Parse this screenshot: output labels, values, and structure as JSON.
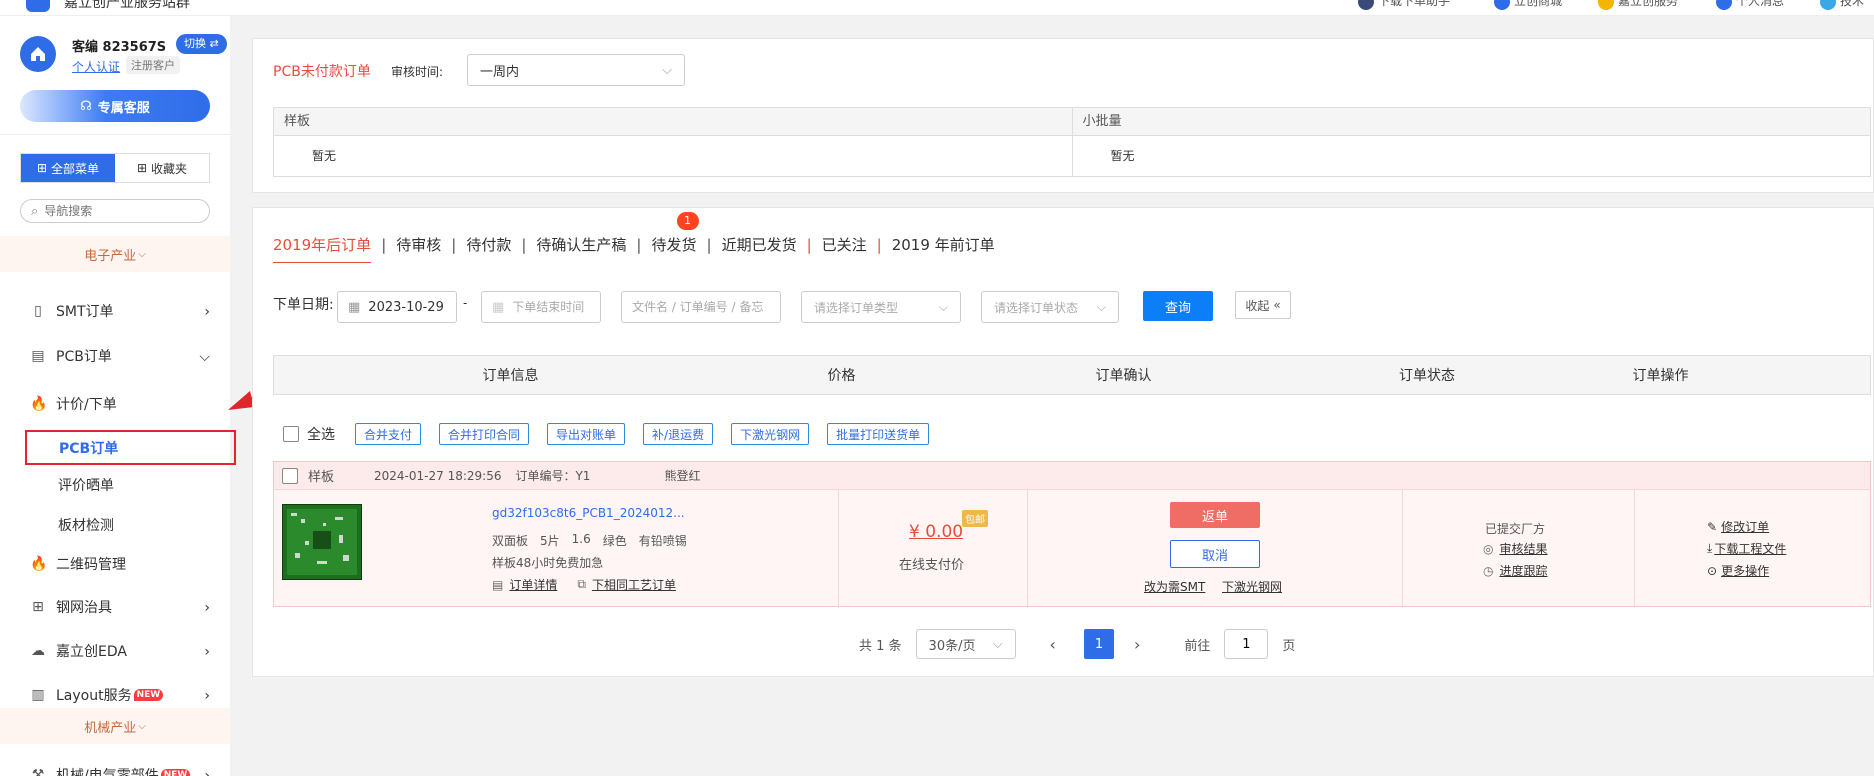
{
  "topbar": {
    "brand": "嘉立创产业服务站群",
    "nav": [
      "下载下单助手",
      "立创商城",
      "嘉立创服务",
      "个人消息",
      "技术"
    ]
  },
  "sidebar": {
    "user_id": "客编 823567S",
    "switch_label": "切换 ⇄",
    "verify_label": "个人认证",
    "reg_tag": "注册客户",
    "service_label": "专属客服",
    "tab_all": "全部菜单",
    "tab_fav": "收藏夹",
    "search_placeholder": "导航搜索",
    "industry_electronics": "电子产业",
    "industry_mech": "机械产业",
    "items": {
      "smt": "SMT订单",
      "pcb": "PCB订单",
      "quote": "计价/下单",
      "pcb_order": "PCB订单",
      "review": "评价晒单",
      "board_test": "板材检测",
      "qr": "二维码管理",
      "stencil": "钢网治具",
      "eda": "嘉立创EDA",
      "layout": "Layout服务",
      "mech": "机械/电气零部件",
      "new": "NEW"
    }
  },
  "unpaid": {
    "title": "PCB未付款订单",
    "review_time_label": "审核时间:",
    "review_time_value": "一周内",
    "col_sample": "样板",
    "col_small": "小批量",
    "empty": "暂无"
  },
  "tabs": {
    "after2019": "2019年后订单",
    "pending_review": "待审核",
    "pending_pay": "待付款",
    "pending_confirm": "待确认生产稿",
    "pending_ship": "待发货",
    "ship_badge": "1",
    "recent_shipped": "近期已发货",
    "followed": "已关注",
    "before2019": "2019 年前订单"
  },
  "filters": {
    "date_label": "下单日期:",
    "start_date": "2023-10-29",
    "dash": "-",
    "end_placeholder": "下单结束时间",
    "keyword_placeholder": "文件名 / 订单编号 / 备忘",
    "type_placeholder": "请选择订单类型",
    "status_placeholder": "请选择订单状态",
    "query": "查询",
    "collapse": "收起"
  },
  "table": {
    "headers": [
      "订单信息",
      "价格",
      "订单确认",
      "订单状态",
      "订单操作"
    ]
  },
  "bulk": {
    "select_all": "全选",
    "actions": [
      "合并支付",
      "合并打印合同",
      "导出对账单",
      "补/退运费",
      "下激光钢网",
      "批量打印送货单"
    ]
  },
  "order": {
    "kind": "样板",
    "time": "2024-01-27 18:29:56",
    "number_label": "订单编号：Y1",
    "contact": "熊登红",
    "filename": "gd32f103c8t6_PCB1_2024012...",
    "spec": [
      "双面板",
      "5片",
      "1.6",
      "绿色",
      "有铅喷锡"
    ],
    "note": "样板48小时免费加急",
    "detail_link": "订单详情",
    "same_process_link": "下相同工艺订单",
    "price": "¥ 0.00",
    "free_ship": "包邮",
    "pay_label": "在线支付价",
    "return_btn": "返单",
    "cancel_btn": "取消",
    "to_smt": "改为需SMT",
    "laser_stencil": "下激光钢网",
    "status": "已提交厂方",
    "audit_result": "审核结果",
    "progress": "进度跟踪",
    "ops": [
      "修改订单",
      "下载工程文件",
      "更多操作"
    ]
  },
  "pager": {
    "total": "共 1 条",
    "per_page": "30条/页",
    "current": "1",
    "goto_label": "前往",
    "goto_value": "1",
    "page_unit": "页"
  },
  "colors": {
    "primary": "#2f6de8",
    "query_btn": "#0b7ef8",
    "accent_red": "#e84c3d",
    "return_btn": "#f06d66"
  }
}
